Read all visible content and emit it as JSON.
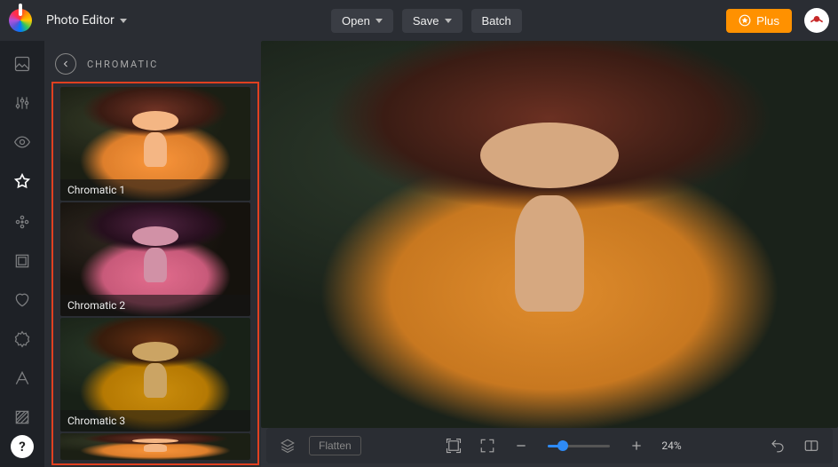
{
  "header": {
    "app_title": "Photo Editor",
    "open_label": "Open",
    "save_label": "Save",
    "batch_label": "Batch",
    "plus_label": "Plus"
  },
  "panel": {
    "title": "CHROMATIC"
  },
  "filters": [
    {
      "label": "Chromatic 1"
    },
    {
      "label": "Chromatic 2"
    },
    {
      "label": "Chromatic 3"
    }
  ],
  "bottombar": {
    "flatten_label": "Flatten",
    "zoom_text": "24%"
  },
  "help_label": "?"
}
